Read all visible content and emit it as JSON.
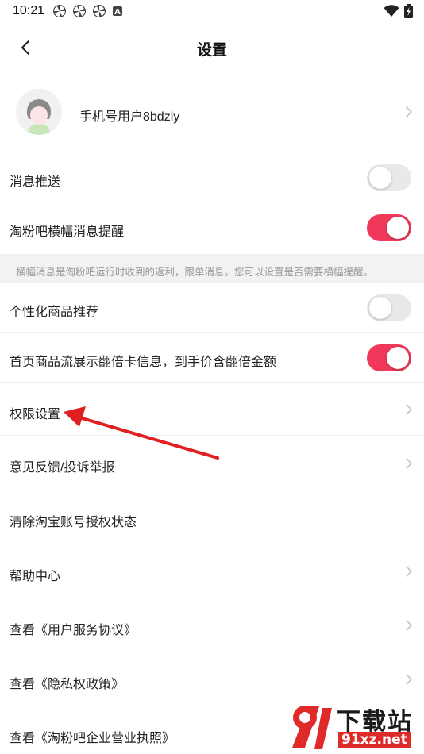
{
  "status_bar": {
    "time": "10:21",
    "left_icons": [
      "pinwheel-icon",
      "pinwheel-icon",
      "pinwheel-icon",
      "a-notification-icon"
    ],
    "right_icons": [
      "wifi-icon",
      "battery-charging-icon"
    ]
  },
  "header": {
    "title": "设置"
  },
  "profile": {
    "name": "手机号用户8bdziy"
  },
  "settings": [
    {
      "label": "消息推送",
      "type": "toggle",
      "on": false
    },
    {
      "label": "淘粉吧横幅消息提醒",
      "type": "toggle",
      "on": true
    },
    {
      "label": "个性化商品推荐",
      "type": "toggle",
      "on": false
    },
    {
      "label": "首页商品流展示翻倍卡信息，到手价含翻倍金额",
      "type": "toggle",
      "on": true
    },
    {
      "label": "权限设置",
      "type": "link"
    },
    {
      "label": "意见反馈/投诉举报",
      "type": "link"
    },
    {
      "label": "清除淘宝账号授权状态",
      "type": "action"
    },
    {
      "label": "帮助中心",
      "type": "link"
    },
    {
      "label": "查看《用户服务协议》",
      "type": "link"
    },
    {
      "label": "查看《隐私权政策》",
      "type": "link"
    },
    {
      "label": "查看《淘粉吧企业营业执照》",
      "type": "link"
    }
  ],
  "banner_note": "横幅消息是淘粉吧运行时收到的返利，跟单消息。您可以设置是否需要横幅提醒。",
  "colors": {
    "toggle_on": "#f0385a",
    "toggle_off": "#e9e9e9",
    "annotation_arrow": "#e02020"
  },
  "watermark": {
    "logo_text": "91",
    "cn_text": "下载站",
    "url_text": "91xz.net"
  }
}
